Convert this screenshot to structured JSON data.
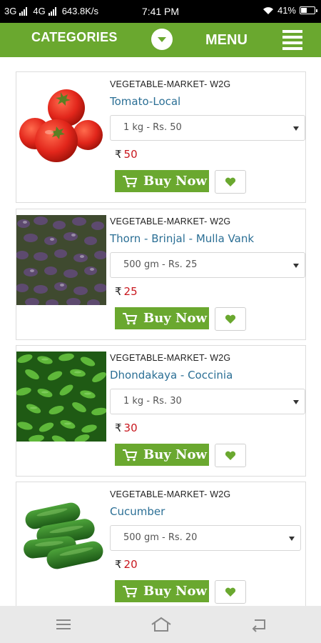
{
  "status_bar": {
    "network_1": "3G",
    "network_2": "4G",
    "speed": "643.8K/s",
    "time": "7:41 PM",
    "battery": "41%"
  },
  "header": {
    "categories_label": "CATEGORIES",
    "menu_label": "MENU"
  },
  "products": [
    {
      "vendor": "VEGETABLE-MARKET- W2G",
      "name": "Tomato-Local",
      "variant": "1 kg - Rs. 50",
      "currency": "₹",
      "price": "50",
      "buy_label": "Buy Now",
      "image_icon": "tomato-image"
    },
    {
      "vendor": "VEGETABLE-MARKET- W2G",
      "name": "Thorn - Brinjal - Mulla Vank",
      "variant": "500 gm - Rs. 25",
      "currency": "₹",
      "price": "25",
      "buy_label": "Buy Now",
      "image_icon": "brinjal-image"
    },
    {
      "vendor": "VEGETABLE-MARKET- W2G",
      "name": "Dhondakaya - Coccinia",
      "variant": "1 kg - Rs. 30",
      "currency": "₹",
      "price": "30",
      "buy_label": "Buy Now",
      "image_icon": "coccinia-image"
    },
    {
      "vendor": "VEGETABLE-MARKET- W2G",
      "name": "Cucumber",
      "variant": "500 gm - Rs. 20",
      "currency": "₹",
      "price": "20",
      "buy_label": "Buy Now",
      "image_icon": "cucumber-image"
    }
  ],
  "colors": {
    "brand_green": "#6aa82f",
    "product_name": "#2b6f95",
    "price_red": "#c8161d"
  }
}
